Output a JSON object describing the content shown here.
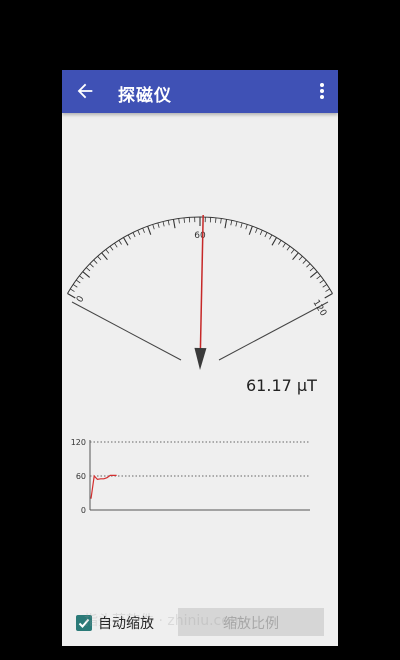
{
  "app": {
    "title": "探磁仪"
  },
  "icons": {
    "back": "arrow-back-icon",
    "menu": "more-vert-icon",
    "check": "checkmark-icon"
  },
  "colors": {
    "appbar": "#3f51b5",
    "needle": "#c62828",
    "chart_line": "#d32f2f",
    "checkbox": "#2b7a78"
  },
  "gauge": {
    "min_label": "0",
    "mid_label": "60",
    "max_label": "120",
    "min": 0,
    "max": 120,
    "value": 61.17
  },
  "readout": {
    "text": "61.17 µT"
  },
  "chart_data": {
    "type": "line",
    "yticks": [
      "0",
      "60",
      "120"
    ],
    "ylim": [
      0,
      120
    ],
    "series": [
      {
        "values": [
          20,
          60,
          54,
          55,
          55,
          57,
          61,
          61,
          61
        ]
      }
    ]
  },
  "controls": {
    "auto_zoom_label": "自动缩放",
    "auto_zoom_checked": true,
    "zoom_button_label": "缩放比例"
  },
  "watermark": {
    "text": "指头范软件 · zhiniu.com"
  }
}
